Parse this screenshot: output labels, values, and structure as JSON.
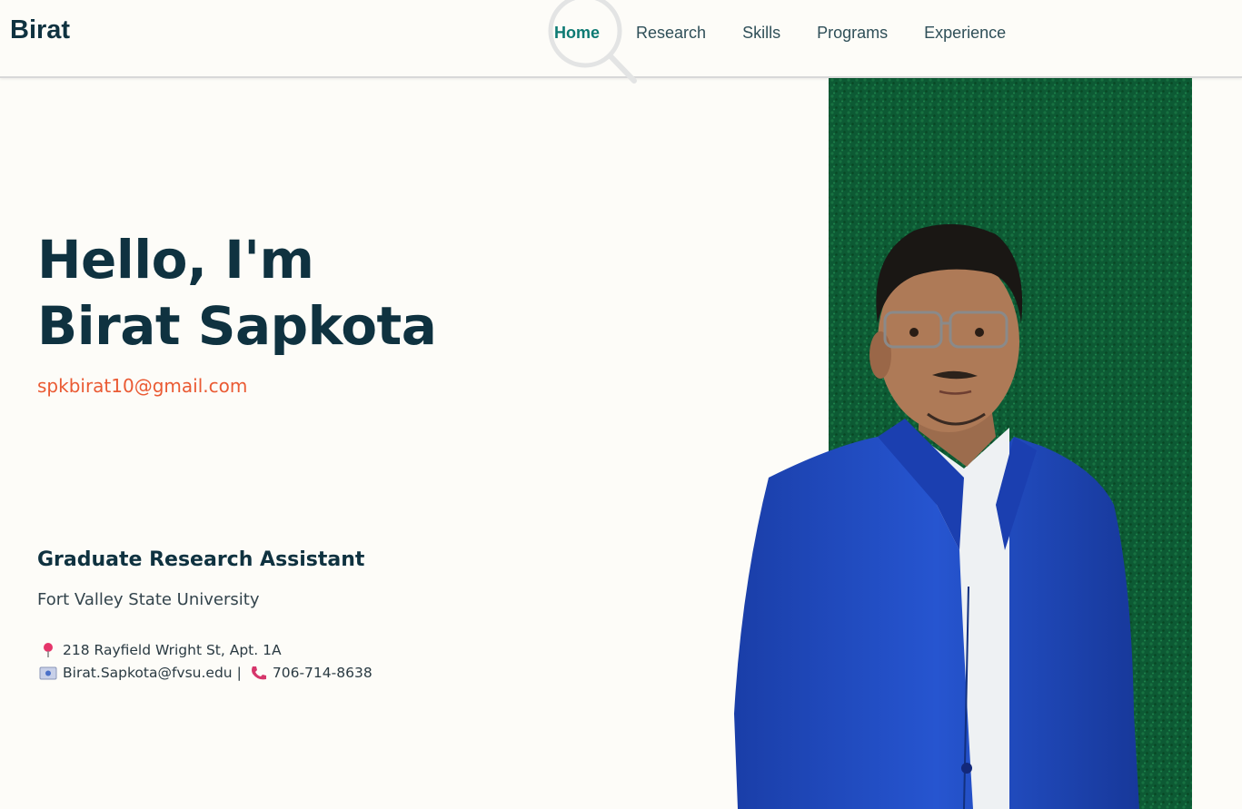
{
  "nav": {
    "brand": "Birat",
    "links": [
      "Home",
      "Research",
      "Skills",
      "Programs",
      "Experience"
    ],
    "active_index": 0
  },
  "hero": {
    "greeting": "Hello, I'm",
    "name": "Birat Sapkota",
    "email": "spkbirat10@gmail.com",
    "role": "Graduate Research Assistant",
    "university": "Fort Valley State University",
    "address": "218 Rayfield Wright St, Apt. 1A",
    "work_email": "Birat.Sapkota@fvsu.edu",
    "separator": "|",
    "phone": "706-714-8638"
  },
  "icons": {
    "address": "pushpin-icon",
    "work_email": "email-icon",
    "phone": "phone-icon"
  },
  "colors": {
    "primary_text": "#0f3240",
    "accent_nav": "#0d7a73",
    "email_accent": "#ea5a33",
    "photo_background": "#0e5a32",
    "blazer": "#1e46b8"
  }
}
